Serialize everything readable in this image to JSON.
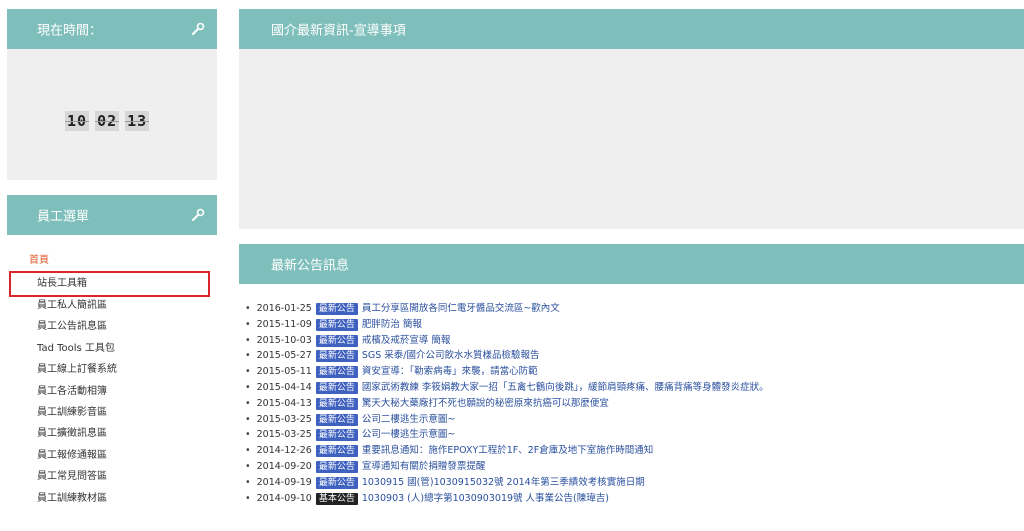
{
  "clock_panel": {
    "title": "現在時間：",
    "hours": "10",
    "minutes": "02",
    "seconds": "13"
  },
  "menu_panel": {
    "title": "員工選單",
    "home": "首頁",
    "items": [
      "站長工具箱",
      "員工私人簡訊區",
      "員工公告訊息區",
      "Tad Tools 工具包",
      "員工線上訂餐系統",
      "員工各活動相簿",
      "員工訓練影音區",
      "員工擴徵訊息區",
      "員工報修通報區",
      "員工常見問答區",
      "員工訓練教材區"
    ]
  },
  "news_panel": {
    "title": "國介最新資訊-宣導事項"
  },
  "announcements_panel": {
    "title": "最新公告訊息",
    "items": [
      {
        "date": "2016-01-25",
        "badge": "最新公告",
        "title": "員工分享區開放各同仁電牙醬品交流區~歡內文"
      },
      {
        "date": "2015-11-09",
        "badge": "最新公告",
        "title": "肥胖防治 簡報"
      },
      {
        "date": "2015-10-03",
        "badge": "最新公告",
        "title": "戒檳及戒菸宣導 簡報"
      },
      {
        "date": "2015-05-27",
        "badge": "最新公告",
        "title": "SGS 采泰/國介公司飲水水質樣品檢驗報告"
      },
      {
        "date": "2015-05-11",
        "badge": "最新公告",
        "title": "資安宣導：「勒索病毒」來襲，請當心防範"
      },
      {
        "date": "2015-04-14",
        "badge": "最新公告",
        "title": "國家武術教練 李筱娟教大家一招「五禽七鶴向後跳」，緩節肩頸疼痛、腰痛背痛等身體發炎症狀。"
      },
      {
        "date": "2015-04-13",
        "badge": "最新公告",
        "title": "驚天大秘大藥廠打不死也願說的秘密原來抗癌可以那麼便宜"
      },
      {
        "date": "2015-03-25",
        "badge": "最新公告",
        "title": "公司二樓逃生示意圖~"
      },
      {
        "date": "2015-03-25",
        "badge": "最新公告",
        "title": "公司一樓逃生示意圖~"
      },
      {
        "date": "2014-12-26",
        "badge": "最新公告",
        "title": "重要訊息通知：施作EPOXY工程於1F、2F倉庫及地下室施作時間通知"
      },
      {
        "date": "2014-09-20",
        "badge": "最新公告",
        "title": "宣導通知有關於捐贈發票提醒"
      },
      {
        "date": "2014-09-19",
        "badge": "最新公告",
        "title": "1030915 國(管)1030915032號 2014年第三季績效考核實施日期"
      },
      {
        "date": "2014-09-10",
        "badge": "基本公告",
        "title": "1030903 (人)總字第1030903019號 人事業公告(陳瑋吉)"
      }
    ]
  },
  "colors": {
    "header": "#7fbfbb",
    "badge": "#3f62c0",
    "highlight": "#d9262c",
    "home_link": "#e05a2c"
  }
}
